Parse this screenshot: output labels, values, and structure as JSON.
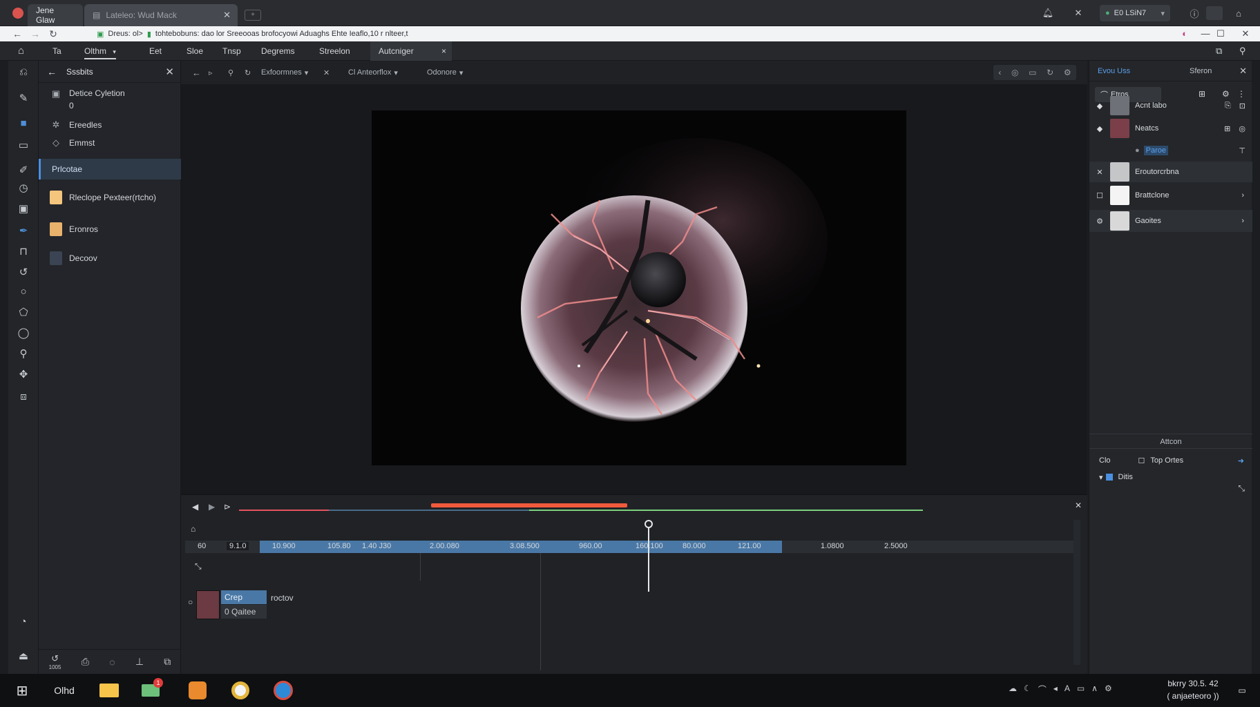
{
  "browser": {
    "tabs": [
      {
        "label": "Jene Glaw",
        "active": true
      },
      {
        "label": "Lateleo: Wud Mack",
        "active": false
      }
    ],
    "profile_label": "E0 LSiN7",
    "address": {
      "prefix": "Dreus: ol>",
      "url": "tohtebobuns: dao lor Sreeooas  brofocyowi  Aduaghs   Ehte Ieaflo,10   r nlteer,t"
    }
  },
  "menubar": {
    "items": [
      "Ta",
      "Olthm",
      "Eet",
      "Sloe",
      "Tnsp",
      "Degrems",
      "Streelon",
      "Autcniger"
    ],
    "active_tab_close": "×"
  },
  "layers_panel": {
    "title": "Sssbits",
    "items": [
      {
        "label": "Detice Cyletion",
        "sub": "0",
        "icon": "frame-icon"
      },
      {
        "label": "Ereedles",
        "icon": "sparkle-icon"
      },
      {
        "label": "Emmst",
        "icon": "tag-icon"
      },
      {
        "label": "Prlcotae",
        "selected": true
      },
      {
        "label": "Rleclope Pexteer(rtcho)",
        "color": "#f3c57d"
      },
      {
        "label": "Eronros",
        "color": "#e8b16c"
      },
      {
        "label": "Decoov",
        "color": "#3a4452"
      }
    ]
  },
  "stage_toolbar": {
    "dropdown1": "Exfoormnes",
    "dropdown2": "Cl Anteorflox",
    "dropdown3": "Odonore"
  },
  "right_panel": {
    "tab_active": "Evou Uss",
    "tab_other": "Sferon",
    "button_label": "Etros",
    "rows": [
      {
        "label": "Acnt labo"
      },
      {
        "label": "Neatcs"
      },
      {
        "label": "Paroe",
        "sub": true
      },
      {
        "label": "Eroutorcrbna"
      },
      {
        "label": "Brattclone"
      },
      {
        "label": "Gaoites"
      }
    ],
    "section_title": "Attcon",
    "prop_label": "Clo",
    "prop_value": "Top Ortes",
    "prop_check": "Ditis"
  },
  "timeline": {
    "frame_start": "60",
    "frame_current": "9.1.0",
    "ticks": [
      "10.900",
      "105.80",
      "1.40 J30",
      "2.00.080",
      "3.08.500",
      "960.00",
      "160.100",
      "80.000",
      "121.00",
      "1.0800",
      "2.5000"
    ],
    "clip_label": "Crep",
    "clip_sub": "0 Qaitee",
    "clip_track": "roctov",
    "left_label": "1005"
  },
  "taskbar": {
    "search_label": "Olhd",
    "notif_badge": "1",
    "clock_time": "bkrry 30.5. 42",
    "clock_date": "( anjaeteoro ))"
  }
}
